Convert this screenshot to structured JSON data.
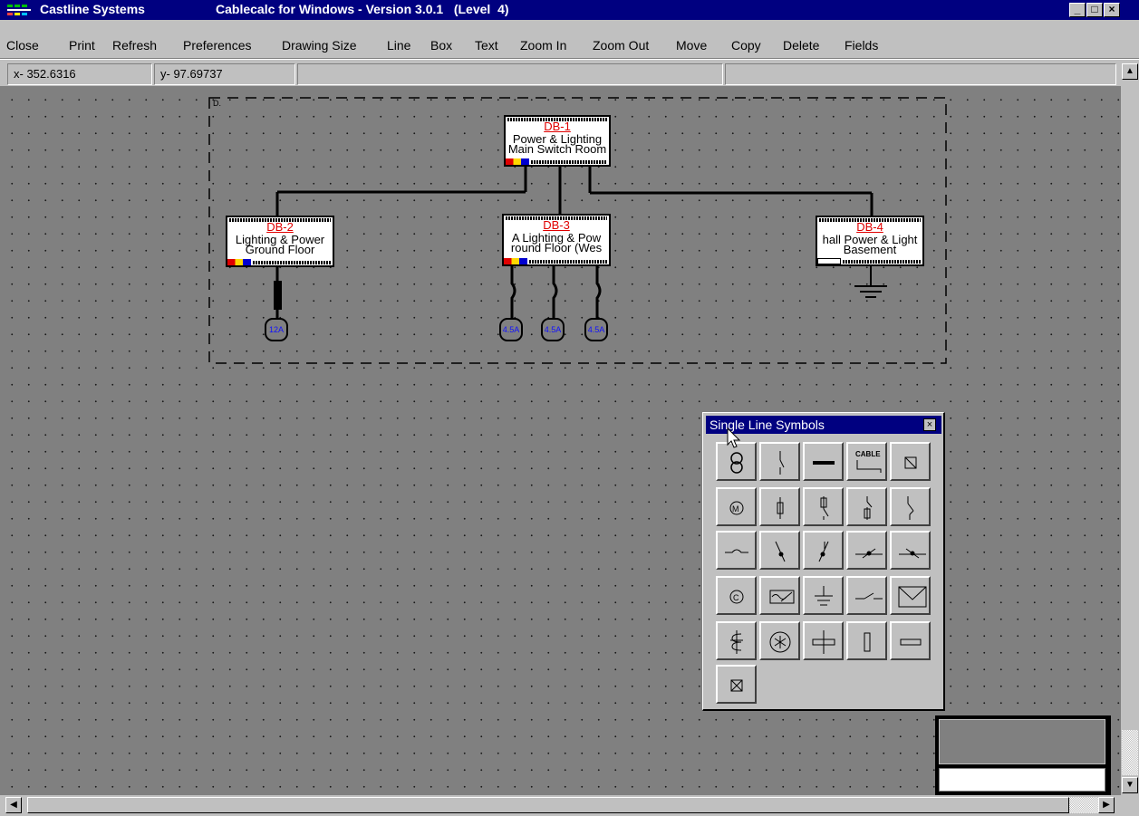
{
  "window": {
    "company": "Castline Systems",
    "title": "Cablecalc for Windows - Version 3.0.1   (Level  4)",
    "minimize": "_",
    "restore": "□",
    "close": "×"
  },
  "menu": {
    "items": [
      "Close",
      "Print",
      "Refresh",
      "Preferences",
      "Drawing Size",
      "Line",
      "Box",
      "Text",
      "Zoom In",
      "Zoom Out",
      "Move",
      "Copy",
      "Delete",
      "Fields"
    ]
  },
  "status": {
    "x": "x- 352.6316",
    "y": "y- 97.69737",
    "field3": "",
    "field4": ""
  },
  "diagram": {
    "group_label": "D.",
    "db1": {
      "code": "DB-1",
      "line1": "Power & Lighting",
      "line2": "Main Switch Room"
    },
    "db2": {
      "code": "DB-2",
      "line1": "Lighting & Power",
      "line2": "Ground Floor"
    },
    "db3": {
      "code": "DB-3",
      "line1": "A Lighting & Pow",
      "line2": "round Floor (Wes"
    },
    "db4": {
      "code": "DB-4",
      "line1": "hall  Power & Light",
      "line2": "Basement"
    },
    "breakers": [
      "12A",
      "4.5A",
      "4.5A",
      "4.5A"
    ]
  },
  "palette": {
    "title": "Single Line Symbols",
    "close": "×",
    "cable_label": "CABLE",
    "rows": [
      [
        "transformer-icon",
        "isolator-icon",
        "busbar-icon",
        "cable-icon",
        "box-diagonal-icon"
      ],
      [
        "motor-icon",
        "fuse-icon",
        "fuse-switch-icon",
        "switch-fuse-icon",
        "disconnector-icon"
      ],
      [
        "link-icon",
        "breaker-open-icon",
        "breaker-closed-icon",
        "mccb-icon",
        "mcb-icon"
      ],
      [
        "capacitor-icon",
        "generator-icon",
        "earth-icon",
        "contact-icon",
        "envelope-icon"
      ],
      [
        "ct-icon",
        "star-icon",
        "cross-bar-icon",
        "vertical-box-icon",
        "horizontal-box-icon"
      ],
      [
        "box-cross-icon"
      ]
    ]
  },
  "colors": {
    "titlebar": "#000080",
    "canvas": "#808080",
    "chrome": "#c0c0c0",
    "db_code": "#e00000",
    "breaker_text": "#1010ff"
  }
}
